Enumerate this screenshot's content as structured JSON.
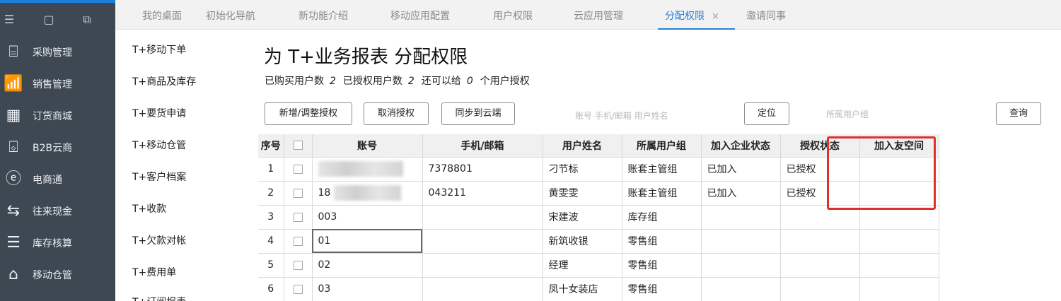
{
  "sidebar": {
    "items": [
      {
        "label": "采购管理",
        "icon": "purchase-icon"
      },
      {
        "label": "销售管理",
        "icon": "sales-chart-icon"
      },
      {
        "label": "订货商城",
        "icon": "store-icon"
      },
      {
        "label": "B2B云商",
        "icon": "b2b-icon"
      },
      {
        "label": "电商通",
        "icon": "ecommerce-icon"
      },
      {
        "label": "往来现金",
        "icon": "cash-icon"
      },
      {
        "label": "库存核算",
        "icon": "inventory-icon"
      },
      {
        "label": "移动仓管",
        "icon": "mobile-warehouse-icon"
      }
    ]
  },
  "tabs": [
    {
      "label": "我的桌面"
    },
    {
      "label": "初始化导航"
    },
    {
      "label": "新功能介绍"
    },
    {
      "label": "移动应用配置"
    },
    {
      "label": "用户权限"
    },
    {
      "label": "云应用管理"
    },
    {
      "label": "分配权限",
      "close": "×"
    },
    {
      "label": "邀请同事"
    }
  ],
  "submenu": [
    "T+移动下单",
    "T+商品及库存",
    "T+要货申请",
    "T+移动仓管",
    "T+客户档案",
    "T+收款",
    "T+欠款对帐",
    "T+费用单",
    "T+订阅报表"
  ],
  "page": {
    "title": "为 T+业务报表 分配权限",
    "stats": {
      "purchased_label": "已购买用户数",
      "purchased": "2",
      "authorized_label": "已授权用户数",
      "authorized": "2",
      "remaining_prefix": "还可以给",
      "remaining": "0",
      "remaining_suffix": "个用户授权"
    }
  },
  "toolbar": {
    "add_adjust": "新增/调整授权",
    "cancel_auth": "取消授权",
    "sync_cloud": "同步到云端",
    "search_placeholder": "账号  手机/邮箱  用户姓名",
    "locate": "定位",
    "group_placeholder": "所属用户组",
    "query": "查询"
  },
  "table": {
    "headers": [
      "序号",
      "",
      "账号",
      "手机/邮箱",
      "用户姓名",
      "所属用户组",
      "加入企业状态",
      "授权状态",
      "加入友空间"
    ],
    "rows": [
      {
        "no": "1",
        "account": "",
        "phone": "7378801",
        "name": "刁节标",
        "group": "账套主管组",
        "join": "已加入",
        "auth": "已授权",
        "space": ""
      },
      {
        "no": "2",
        "account": "18",
        "phone": "043211",
        "name": "黄雯雯",
        "group": "账套主管组",
        "join": "已加入",
        "auth": "已授权",
        "space": ""
      },
      {
        "no": "3",
        "account": "003",
        "phone": "",
        "name": "宋建波",
        "group": "库存组",
        "join": "",
        "auth": "",
        "space": ""
      },
      {
        "no": "4",
        "account": "01",
        "phone": "",
        "name": "新筑收银",
        "group": "零售组",
        "join": "",
        "auth": "",
        "space": ""
      },
      {
        "no": "5",
        "account": "02",
        "phone": "",
        "name": "经理",
        "group": "零售组",
        "join": "",
        "auth": "",
        "space": ""
      },
      {
        "no": "6",
        "account": "03",
        "phone": "",
        "name": "凤十女装店",
        "group": "零售组",
        "join": "",
        "auth": "",
        "space": ""
      }
    ]
  },
  "colors": {
    "sidebar_bg": "#3e4853",
    "accent": "#2a7fd4",
    "highlight": "#e0302b"
  }
}
